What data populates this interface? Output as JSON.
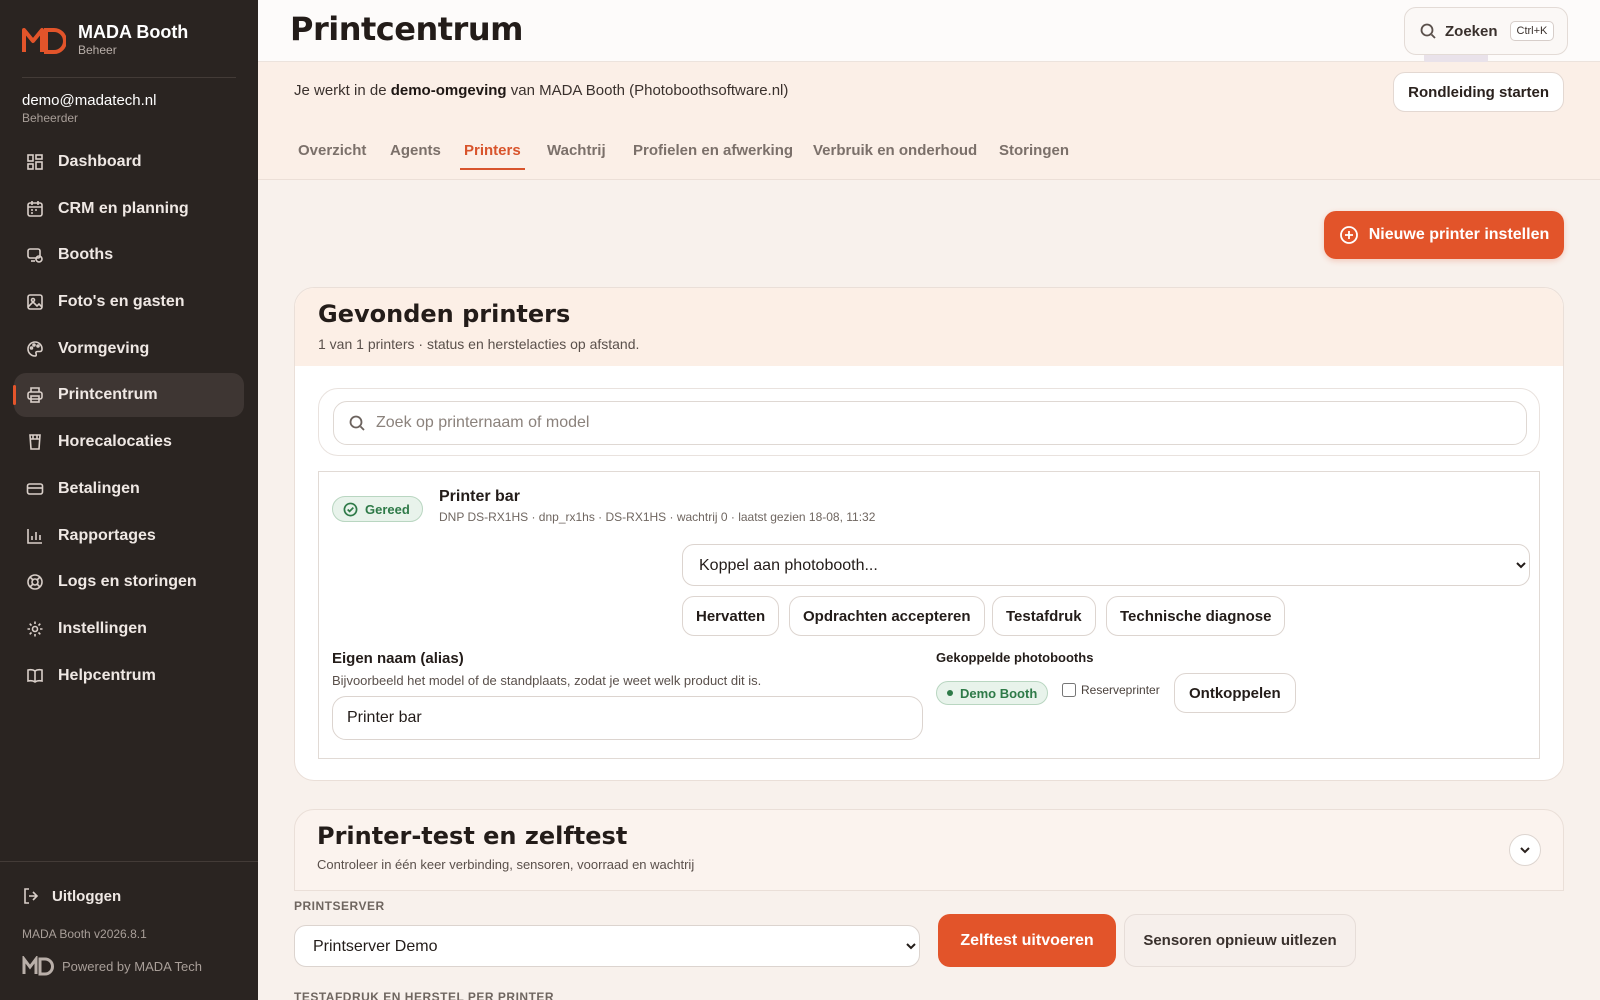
{
  "brand": {
    "name": "MADA Booth",
    "sub": "Beheer"
  },
  "user": {
    "email": "demo@madatech.nl",
    "role": "Beheerder"
  },
  "sidebar": {
    "items": [
      {
        "label": "Dashboard",
        "icon": "dashboard-icon"
      },
      {
        "label": "CRM en planning",
        "icon": "calendar-icon"
      },
      {
        "label": "Booths",
        "icon": "booth-icon"
      },
      {
        "label": "Foto's en gasten",
        "icon": "image-icon"
      },
      {
        "label": "Vormgeving",
        "icon": "palette-icon"
      },
      {
        "label": "Printcentrum",
        "icon": "printer-icon",
        "active": true
      },
      {
        "label": "Horecalocaties",
        "icon": "glass-icon"
      },
      {
        "label": "Betalingen",
        "icon": "credit-card-icon"
      },
      {
        "label": "Rapportages",
        "icon": "bar-chart-icon"
      },
      {
        "label": "Logs en storingen",
        "icon": "lifebuoy-icon"
      },
      {
        "label": "Instellingen",
        "icon": "gear-icon"
      },
      {
        "label": "Helpcentrum",
        "icon": "book-icon"
      }
    ],
    "logout": "Uitloggen",
    "version": "MADA Booth v2026.8.1",
    "powered": "Powered by MADA Tech"
  },
  "header": {
    "title": "Printcentrum",
    "search_label": "Zoeken",
    "search_shortcut": "Ctrl+K"
  },
  "demo": {
    "prefix": "Je werkt in de ",
    "bold": "demo-omgeving",
    "suffix": " van MADA Booth (Photoboothsoftware.nl)",
    "tour_button": "Rondleiding starten"
  },
  "tabs": [
    {
      "label": "Overzicht"
    },
    {
      "label": "Agents"
    },
    {
      "label": "Printers",
      "active": true
    },
    {
      "label": "Wachtrij"
    },
    {
      "label": "Profielen en afwerking"
    },
    {
      "label": "Verbruik en onderhoud"
    },
    {
      "label": "Storingen"
    }
  ],
  "actions": {
    "new_printer": "Nieuwe printer instellen"
  },
  "found": {
    "title": "Gevonden printers",
    "subtitle": "1 van 1 printers · status en herstelacties op afstand.",
    "search_placeholder": "Zoek op printernaam of model",
    "printer": {
      "status": "Gereed",
      "name": "Printer bar",
      "meta": "DNP DS-RX1HS · dnp_rx1hs · DS-RX1HS · wachtrij 0 · laatst gezien 18-08, 11:32",
      "booth_select": "Koppel aan photobooth...",
      "buttons": {
        "resume": "Hervatten",
        "accept": "Opdrachten accepteren",
        "testprint": "Testafdruk",
        "diagnose": "Technische diagnose"
      },
      "alias_label": "Eigen naam (alias)",
      "alias_help": "Bijvoorbeeld het model of de standplaats, zodat je weet welk product dit is.",
      "alias_value": "Printer bar",
      "linked_label": "Gekoppelde photobooths",
      "linked_booth": "Demo Booth",
      "reserve_label": "Reserveprinter",
      "unlink": "Ontkoppelen"
    }
  },
  "selftest": {
    "title": "Printer-test en zelftest",
    "subtitle": "Controleer in één keer verbinding, sensoren, voorraad en wachtrij",
    "printserver_label": "PRINTSERVER",
    "printserver_value": "Printserver Demo",
    "run_button": "Zelftest uitvoeren",
    "sensors_button": "Sensoren opnieuw uitlezen",
    "next_section_label": "TESTAFDRUK EN HERSTEL PER PRINTER"
  },
  "colors": {
    "accent": "#e2542a",
    "sidebar": "#2a2421",
    "success": "#2e7a48"
  }
}
